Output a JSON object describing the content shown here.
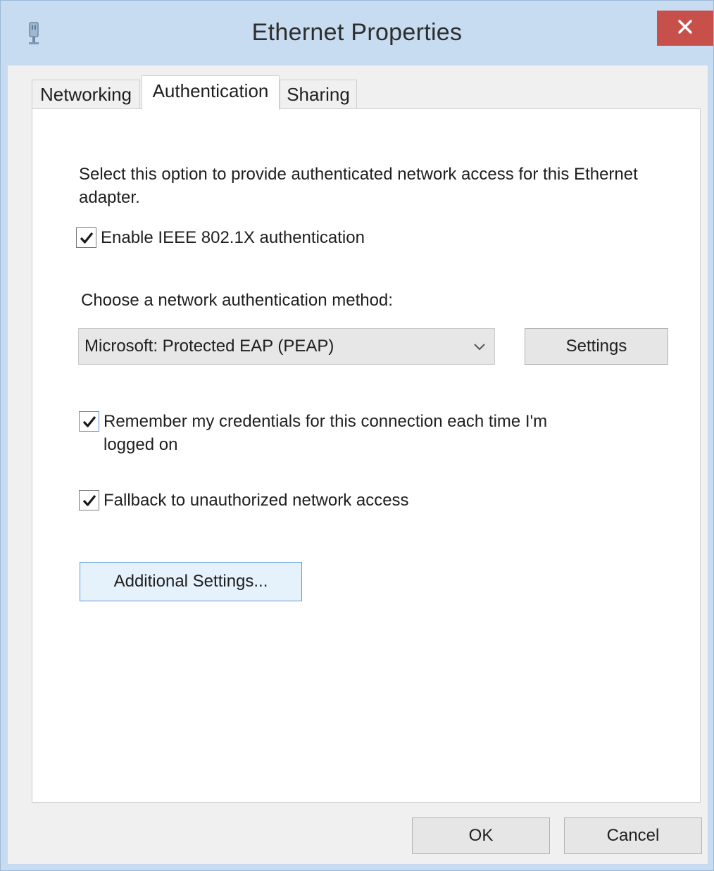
{
  "window": {
    "title": "Ethernet Properties"
  },
  "tabs": [
    {
      "label": "Networking",
      "active": false
    },
    {
      "label": "Authentication",
      "active": true
    },
    {
      "label": "Sharing",
      "active": false
    }
  ],
  "authentication": {
    "description": "Select this option to provide authenticated network access for this Ethernet adapter.",
    "enable_8021x": {
      "label": "Enable IEEE 802.1X authentication",
      "checked": true
    },
    "method_label": "Choose a network authentication method:",
    "method_select": {
      "value": "Microsoft: Protected EAP (PEAP)"
    },
    "settings_button": "Settings",
    "remember_credentials": {
      "label": "Remember my credentials for this connection each time I'm logged on",
      "checked": true
    },
    "fallback": {
      "label": "Fallback to unauthorized network access",
      "checked": true
    },
    "additional_settings_button": "Additional Settings..."
  },
  "footer": {
    "ok_button": "OK",
    "cancel_button": "Cancel"
  },
  "colors": {
    "frame": "#c7dcf1",
    "close_button": "#c7514a",
    "focus_border": "#5d9bd6"
  },
  "icons": {
    "app": "ethernet-icon",
    "close": "close-icon",
    "check": "check-icon",
    "dropdown": "chevron-down-icon"
  }
}
